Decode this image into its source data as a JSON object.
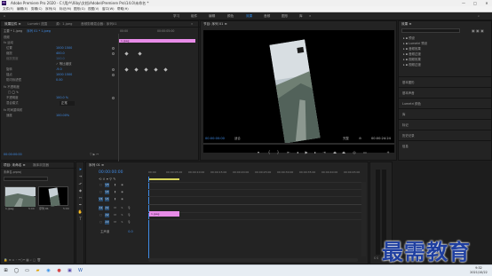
{
  "window": {
    "app_icon": "Pr",
    "title": "Adobe Premiere Pro 2020 - C:\\用户\\Xiby\\文档\\Adobe\\Premiere Pro\\14.0\\未命名 *",
    "min": "—",
    "max": "□",
    "close": "✕"
  },
  "menu": [
    "文件(F)",
    "编辑(E)",
    "剪辑(C)",
    "序列(S)",
    "标记(M)",
    "图形(G)",
    "视图(V)",
    "窗口(W)",
    "帮助(H)"
  ],
  "workspaces": [
    {
      "label": "学习",
      "active": false
    },
    {
      "label": "组件",
      "active": false
    },
    {
      "label": "编辑",
      "active": false
    },
    {
      "label": "颜色",
      "active": false
    },
    {
      "label": "效果",
      "active": true
    },
    {
      "label": "音频",
      "active": false
    },
    {
      "label": "图形",
      "active": false
    },
    {
      "label": "库",
      "active": false
    }
  ],
  "effect_controls": {
    "tabs": [
      "效果控件 ≡",
      "Lumetri 范围",
      "源：1.jpeg",
      "音频剪辑混合器：序列01"
    ],
    "source": "主要 * 1.jpeg",
    "sequence": "序列 01 * 1.jpeg",
    "timecode_start": "00:00",
    "timecode_end": "00:00:05:00",
    "clip_label": "1.jpeg",
    "section_video": "视频",
    "section_motion": "fx 运动",
    "properties": [
      {
        "label": "位置",
        "value": "1000  1500"
      },
      {
        "label": "缩放",
        "value": "400.0"
      },
      {
        "label": "缩放宽度",
        "value": "100.0"
      },
      {
        "label": "",
        "value": "✓ 等比缩放"
      },
      {
        "label": "旋转",
        "value": "-9.0"
      },
      {
        "label": "锚点",
        "value": "1000  1500"
      },
      {
        "label": "防闪烁滤镜",
        "value": "0.00"
      },
      {
        "label": "fx 不透明度",
        "value": ""
      },
      {
        "label": "",
        "value": "□ ◯ ✎"
      },
      {
        "label": "不透明度",
        "value": "100.0 %"
      },
      {
        "label": "混合模式",
        "value": "正常"
      },
      {
        "label": "fx 时间重映射",
        "value": ""
      },
      {
        "label": "速度",
        "value": "100.00%"
      }
    ],
    "footer_timecode": "00:00:00:00"
  },
  "program_monitor": {
    "title": "节目: 序列 01 ≡",
    "timecode_left": "00:00:00:00",
    "fit": "适合",
    "quality": "完整",
    "timecode_right": "00:00:24:24"
  },
  "right_panel": {
    "header": "效果 ≡",
    "tree": [
      "预设",
      "Lumetri 预设",
      "音频效果",
      "音频过渡",
      "视频效果",
      "视频过渡"
    ],
    "sections": [
      "基本图形",
      "基本声音",
      "Lumetri 颜色",
      "库",
      "标记",
      "历史记录",
      "信息"
    ]
  },
  "project_panel": {
    "tabs": [
      "项目: 未命名 ≡",
      "媒体浏览器"
    ],
    "project_file": "未命名.prproj",
    "items": [
      {
        "name": "1.jpeg",
        "duration": "5:00"
      },
      {
        "name": "序列 01",
        "duration": "5:00"
      }
    ]
  },
  "timeline": {
    "sequence_tab": "序列 01 ≡",
    "timecode": "00:00:00:00",
    "ruler": [
      "00:00",
      "00:00:05:00",
      "00:00:10:00",
      "00:00:15:00",
      "00:00:20:00",
      "00:00:25:00",
      "00:00:30:00",
      "00:00:35:00",
      "00:00:40:00",
      "00:00:45:00"
    ],
    "tracks": [
      {
        "id": "V3",
        "kind": "video"
      },
      {
        "id": "V2",
        "kind": "video"
      },
      {
        "id": "V1",
        "kind": "video"
      },
      {
        "id": "A1",
        "kind": "audio"
      },
      {
        "id": "A2",
        "kind": "audio"
      },
      {
        "id": "A3",
        "kind": "audio"
      }
    ],
    "master": "主声道",
    "master_value": "0.0",
    "clip": "1.jpeg"
  },
  "taskbar": {
    "time": "9:32",
    "date": "2021/10/22"
  },
  "watermark": "最需教育",
  "colors": {
    "accent": "#2d8ceb",
    "clip": "#e88ce8",
    "value_blue": "#3f8be6"
  }
}
